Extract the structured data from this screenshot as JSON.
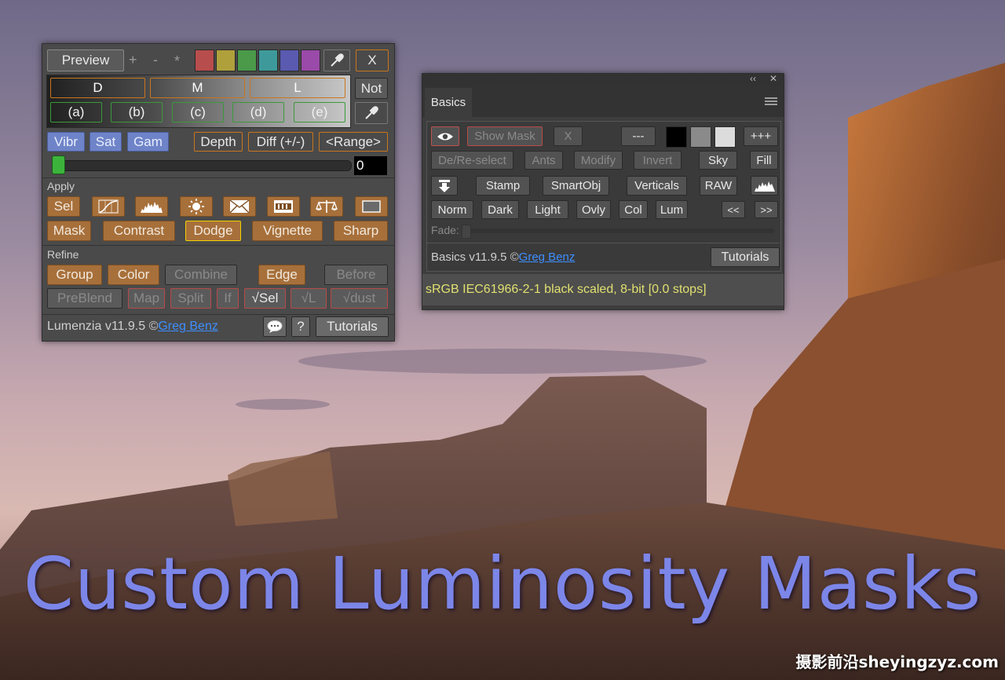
{
  "headline": "Custom Luminosity Masks",
  "watermark": "摄影前沿sheyingzyz.com",
  "lumenzia": {
    "preview": "Preview",
    "plus": "+",
    "minus": "-",
    "star": "*",
    "close": "X",
    "swatches": [
      "#b84d4d",
      "#b0a03c",
      "#4a9a4a",
      "#3e9a9a",
      "#5a5ab0",
      "#9a4aa8"
    ],
    "dml": [
      "D",
      "M",
      "L"
    ],
    "not": "Not",
    "zones": [
      "(a)",
      "(b)",
      "(c)",
      "(d)",
      "(e)"
    ],
    "vibr": "Vibr",
    "sat": "Sat",
    "gam": "Gam",
    "depth": "Depth",
    "diff": "Diff (+/-)",
    "range": "<Range>",
    "slider_value": "0",
    "slider_fraction": 0.02,
    "apply_label": "Apply",
    "apply_row1_icons": [
      "sel-text",
      "curves-icon",
      "histogram-icon",
      "brightness-icon",
      "envelope-icon",
      "film-icon",
      "balance-icon",
      "rectangle-icon"
    ],
    "sel": "Sel",
    "mask": "Mask",
    "contrast": "Contrast",
    "dodge": "Dodge",
    "vignette": "Vignette",
    "sharp": "Sharp",
    "refine_label": "Refine",
    "group": "Group",
    "color": "Color",
    "combine": "Combine",
    "edge": "Edge",
    "before": "Before",
    "preblend": "PreBlend",
    "map": "Map",
    "split": "Split",
    "if": "If",
    "check_sel": "√Sel",
    "check_l": "√L",
    "check_dust": "√dust",
    "footer_version": "Lumenzia v11.9.5 ©",
    "footer_author": "Greg Benz",
    "help": "?",
    "tutorials": "Tutorials"
  },
  "basics": {
    "collapse": "‹‹",
    "close": "✕",
    "tab": "Basics",
    "show_mask": "Show Mask",
    "x": "X",
    "minus3": "---",
    "plus3": "+++",
    "gray_swatches": [
      "#000000",
      "#8a8a8a",
      "#dcdcdc"
    ],
    "deselect": "De/Re-select",
    "ants": "Ants",
    "modify": "Modify",
    "invert": "Invert",
    "sky": "Sky",
    "fill": "Fill",
    "stamp": "Stamp",
    "smartobj": "SmartObj",
    "verticals": "Verticals",
    "raw": "RAW",
    "norm": "Norm",
    "dark": "Dark",
    "light": "Light",
    "ovly": "Ovly",
    "col": "Col",
    "lum": "Lum",
    "prev": "<<",
    "next": ">>",
    "fade_label": "Fade:",
    "footer_version": "Basics v11.9.5 ©",
    "footer_author": "Greg Benz",
    "tutorials": "Tutorials",
    "status": "sRGB IEC61966-2-1 black scaled, 8-bit [0.0 stops]"
  }
}
